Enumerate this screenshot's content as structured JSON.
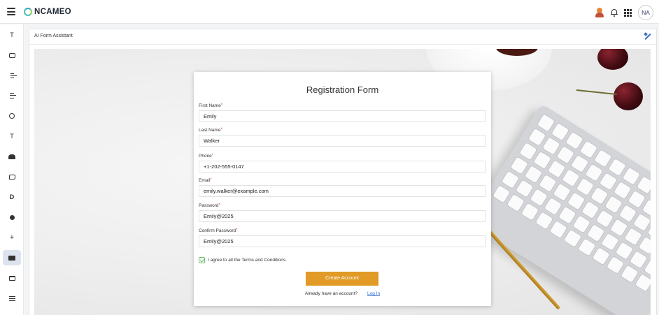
{
  "header": {
    "logo_text": "NCAMEO",
    "avatar_initials": "NA",
    "icons": [
      "hamburger-icon",
      "user-icon",
      "bell-icon",
      "grid-icon"
    ]
  },
  "sidebar": {
    "items": [
      {
        "name": "text-tool",
        "glyph": "T"
      },
      {
        "name": "chat",
        "glyph": ""
      },
      {
        "name": "database",
        "glyph": ""
      },
      {
        "name": "tasks",
        "glyph": ""
      },
      {
        "name": "users",
        "glyph": ""
      },
      {
        "name": "title-tool",
        "glyph": "T"
      },
      {
        "name": "robot",
        "glyph": ""
      },
      {
        "name": "comments",
        "glyph": ""
      },
      {
        "name": "document",
        "glyph": "D"
      },
      {
        "name": "settings",
        "glyph": ""
      },
      {
        "name": "add",
        "glyph": "+"
      },
      {
        "name": "form-assistant",
        "glyph": ""
      },
      {
        "name": "calendar",
        "glyph": ""
      },
      {
        "name": "list",
        "glyph": ""
      }
    ]
  },
  "panel": {
    "title": "AI Form Assistant"
  },
  "form": {
    "title": "Registration Form",
    "fields": {
      "first_name": {
        "label": "First Name",
        "value": "Emily"
      },
      "last_name": {
        "label": "Last Name",
        "value": "Walker"
      },
      "phone": {
        "label": "Phone",
        "value": "+1-202-555-0147"
      },
      "email": {
        "label": "Email",
        "value": "emily.walker@example.com"
      },
      "password": {
        "label": "Password",
        "value": "Emily@2025"
      },
      "confirm_password": {
        "label": "Confirm Password",
        "value": "Emily@2025"
      }
    },
    "required_mark": "*",
    "agree_text": "I agree to all the Terms and Conditions.",
    "agree_checked": true,
    "submit_label": "Create Account",
    "login_prompt": "Already have an account?",
    "login_link": "Log In"
  },
  "colors": {
    "accent": "#e09a25",
    "link": "#2f6fd1",
    "check": "#6bbf6e",
    "required": "#d0402f"
  }
}
